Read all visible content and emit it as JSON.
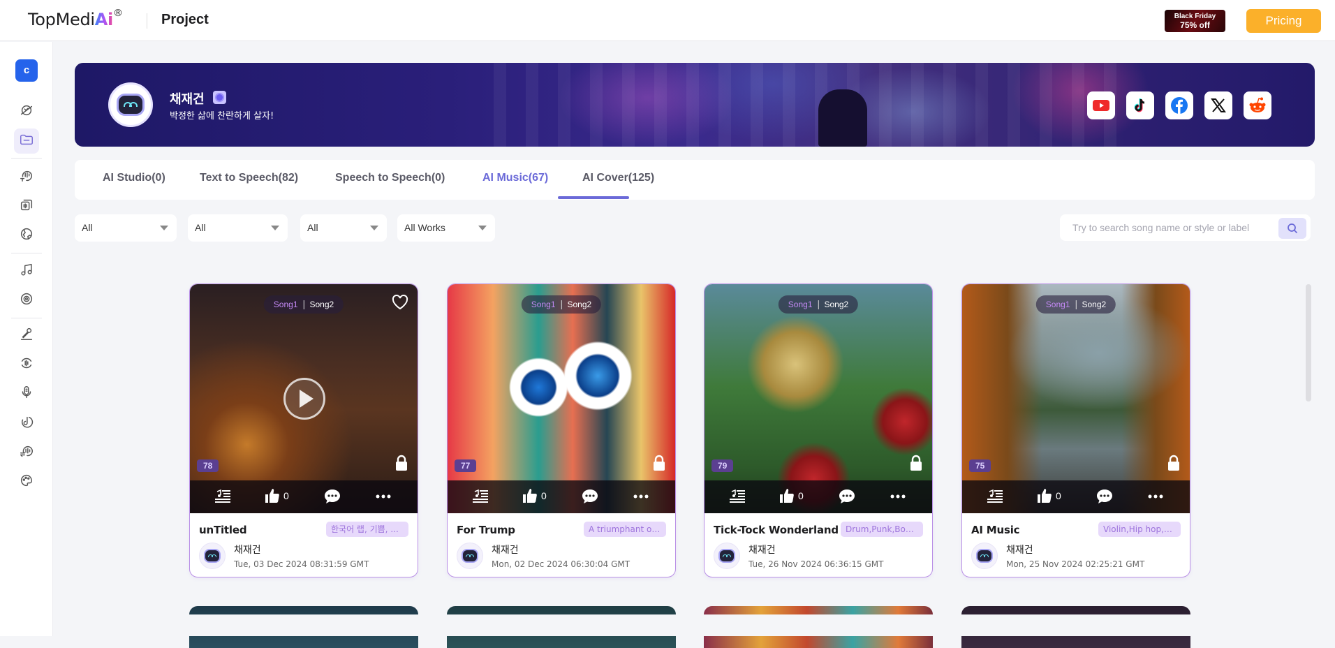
{
  "header": {
    "logo_text": "TopMedi",
    "logo_ai": "Ai",
    "logo_reg": "®",
    "page_title": "Project",
    "promo_line1": "Black Friday",
    "promo_line2": "75% off",
    "pricing_label": "Pricing",
    "accent": "#fbb02a"
  },
  "sidebar": {
    "user_initial": "c",
    "items": [
      {
        "icon": "ai-studio-icon",
        "active": false
      },
      {
        "icon": "folder-icon",
        "active": true
      },
      {
        "icon": "text-to-speech-icon",
        "active": false
      },
      {
        "icon": "voice-library-icon",
        "active": false
      },
      {
        "icon": "globe-icon",
        "active": false
      },
      {
        "icon": "music-note-icon",
        "active": false
      },
      {
        "icon": "disc-icon",
        "active": false
      },
      {
        "icon": "microphone-icon",
        "active": false
      },
      {
        "icon": "voice-changer-icon",
        "active": false
      },
      {
        "icon": "vocal-remover-icon",
        "active": false
      },
      {
        "icon": "tiktok-voice-icon",
        "active": false
      },
      {
        "icon": "speech-to-speech-icon",
        "active": false
      },
      {
        "icon": "palette-icon",
        "active": false
      }
    ]
  },
  "profile": {
    "name": "채재건",
    "motto": "박정한 삶에 찬란하게 살자!",
    "social": [
      "youtube",
      "tiktok",
      "facebook",
      "x",
      "reddit"
    ]
  },
  "tabs": [
    {
      "label": "AI Studio(0)",
      "active": false
    },
    {
      "label": "Text to Speech(82)",
      "active": false
    },
    {
      "label": "Speech to Speech(0)",
      "active": false
    },
    {
      "label": "AI Music(67)",
      "active": true
    },
    {
      "label": "AI Cover(125)",
      "active": false
    }
  ],
  "filters": [
    {
      "value": "All"
    },
    {
      "value": "All"
    },
    {
      "value": "All"
    },
    {
      "value": "All Works"
    }
  ],
  "search": {
    "placeholder": "Try to search song name or style or label",
    "value": ""
  },
  "cards": [
    {
      "song1": "Song1",
      "song2": "Song2",
      "score": "78",
      "likes": "0",
      "title": "unTitled",
      "tag": "한국어 랩, 기쁨, ...",
      "user": "채재건",
      "date": "Tue, 03 Dec 2024 08:31:59 GMT",
      "has_play": true,
      "has_heart": true
    },
    {
      "song1": "Song1",
      "song2": "Song2",
      "score": "77",
      "likes": "0",
      "title": "For Trump",
      "tag": "A triumphant or...",
      "user": "채재건",
      "date": "Mon, 02 Dec 2024 06:30:04 GMT",
      "has_play": false,
      "has_heart": false
    },
    {
      "song1": "Song1",
      "song2": "Song2",
      "score": "79",
      "likes": "0",
      "title": "Tick-Tock Wonderland",
      "tag": "Drum,Punk,Boun...",
      "user": "채재건",
      "date": "Tue, 26 Nov 2024 06:36:15 GMT",
      "has_play": false,
      "has_heart": false
    },
    {
      "song1": "Song1",
      "song2": "Song2",
      "score": "75",
      "likes": "0",
      "title": "AI Music",
      "tag": "Violin,Hip hop,A...",
      "user": "채재건",
      "date": "Mon, 25 Nov 2024 02:25:21 GMT",
      "has_play": false,
      "has_heart": false
    }
  ]
}
